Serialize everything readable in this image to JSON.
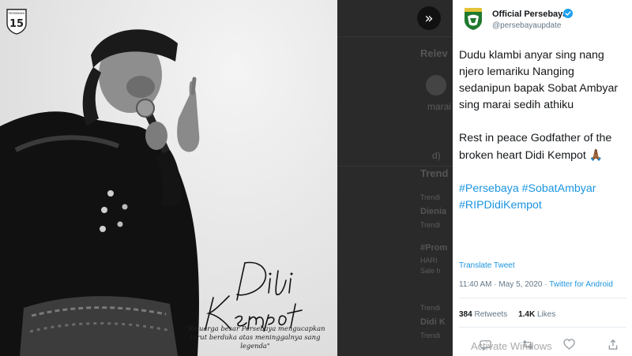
{
  "photo": {
    "club_logo": "persebaya-crest-icon",
    "signature_text": "Didi Kempot",
    "condolence": [
      "\"Keluarga besar Persebaya mengucapkan",
      "turut berduka atas meninggalnya sang legenda\""
    ]
  },
  "background": {
    "ghost_heading": "Relev",
    "ghost_text_1": "marai",
    "ghost_text_2": "d)",
    "ghost_trends": "Trend",
    "ghost_items": [
      "Trendi",
      "Dienia",
      "Trendi",
      "#Prom",
      "HARI",
      "Sale h",
      "Trendi",
      "Didi K",
      "Trendi"
    ]
  },
  "collapse_button": {
    "icon": "double-chevron-right-icon",
    "glyph": "»"
  },
  "tweet": {
    "author_name": "Official Persebaya",
    "author_handle": "@persebayaupdate",
    "paragraph_1": "Dudu klambi anyar sing nang njero lemariku Nanging sedanipun bapak Sobat Ambyar sing marai sedih athiku",
    "paragraph_2": "Rest in peace Godfather of the broken heart Didi Kempot",
    "prayer_emoji": "🙏🏾",
    "hashtags": "#Persebaya #SobatAmbyar #RIPDidiKempot",
    "translate_label": "Translate Tweet",
    "time": "11:40 AM",
    "separator": "·",
    "date": "May 5, 2020",
    "client": "Twitter for Android",
    "retweets_count": "384",
    "retweets_label": "Retweets",
    "likes_count": "1.4K",
    "likes_label": "Likes"
  },
  "watermark": "Activate Windows",
  "colors": {
    "link": "#1b95e0",
    "verified": "#1da1f2",
    "text": "#14171a",
    "muted": "#657786"
  }
}
